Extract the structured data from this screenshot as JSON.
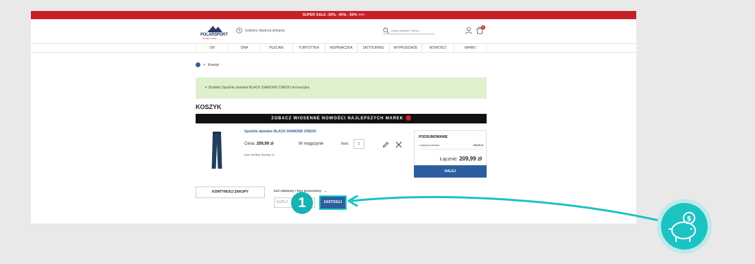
{
  "sale_bar": {
    "text": "SUPER SALE -30%, -40%, -50% >>>"
  },
  "header": {
    "logo": {
      "name": "POLARSPORT",
      "tagline": "twój sklep outdoor"
    },
    "hours_text": "Godziny otwarcia sklepów",
    "search": {
      "placeholder": "Czego szukasz? Wpisz..."
    },
    "cart_count": "0"
  },
  "nav": {
    "items": [
      "ON",
      "ONA",
      "PLECAKI",
      "TURYSTYKA",
      "WSPINACZKA",
      "SKITOURING",
      "WYPRZEDAŻE",
      "NOWOŚCI",
      "MARKI"
    ]
  },
  "breadcrumb": {
    "current": "Koszyk",
    "separator": ">"
  },
  "alert": {
    "text": "✔ Dodałeś Spodnie damskie BLACK DIAMOND CREDO do koszyka."
  },
  "page_title": "KOSZYK",
  "promo_banner": {
    "text": "ZOBACZ WIOSENNE NOWOŚCI NAJLEPSZYCH MAREK"
  },
  "product": {
    "name": "Spodnie damskie BLACK DIAMOND CREDO",
    "price_label": "Cena:",
    "price_value": "209,99 zł",
    "stock": "W magazynie",
    "qty_label": "Ilość:",
    "qty_value": "1",
    "attrs": "Kolor: Ink Blue, Rozmiar: 10"
  },
  "summary": {
    "title": "PODSUMOWANIE",
    "row_label": "1 artykuł produktów",
    "row_value": "209,99 zł",
    "total_label": "Łącznie:",
    "total_value": "209,99 zł",
    "next_label": "DALEJ"
  },
  "continue_label": "KONTYNUUJ ZAKUPY",
  "coupon": {
    "label": "kod rabatowy / bon prezentowy",
    "chevron": "⌄",
    "placeholder": "KUPUJ",
    "apply_label": "ZASTOSUJ"
  },
  "step_badge": "1",
  "colors": {
    "sale_red": "#c62027",
    "brand_blue": "#2d5fa0",
    "alert_green": "#dff0cf",
    "accent_teal": "#17c3c3"
  }
}
